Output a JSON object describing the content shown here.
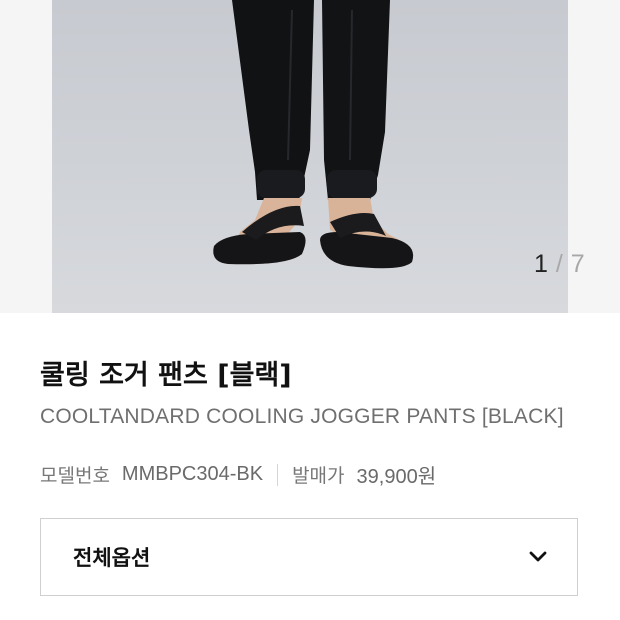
{
  "gallery": {
    "current": "1",
    "separator": "/",
    "total": "7"
  },
  "product": {
    "title": "쿨링 조거 팬츠 [블랙]",
    "subtitle": "COOLTANDARD COOLING JOGGER PANTS [BLACK]",
    "model_label": "모델번호",
    "model_value": "MMBPC304-BK",
    "price_label": "발매가",
    "price_value": "39,900원"
  },
  "options": {
    "label": "전체옵션",
    "icon": "chevron-down-icon"
  }
}
